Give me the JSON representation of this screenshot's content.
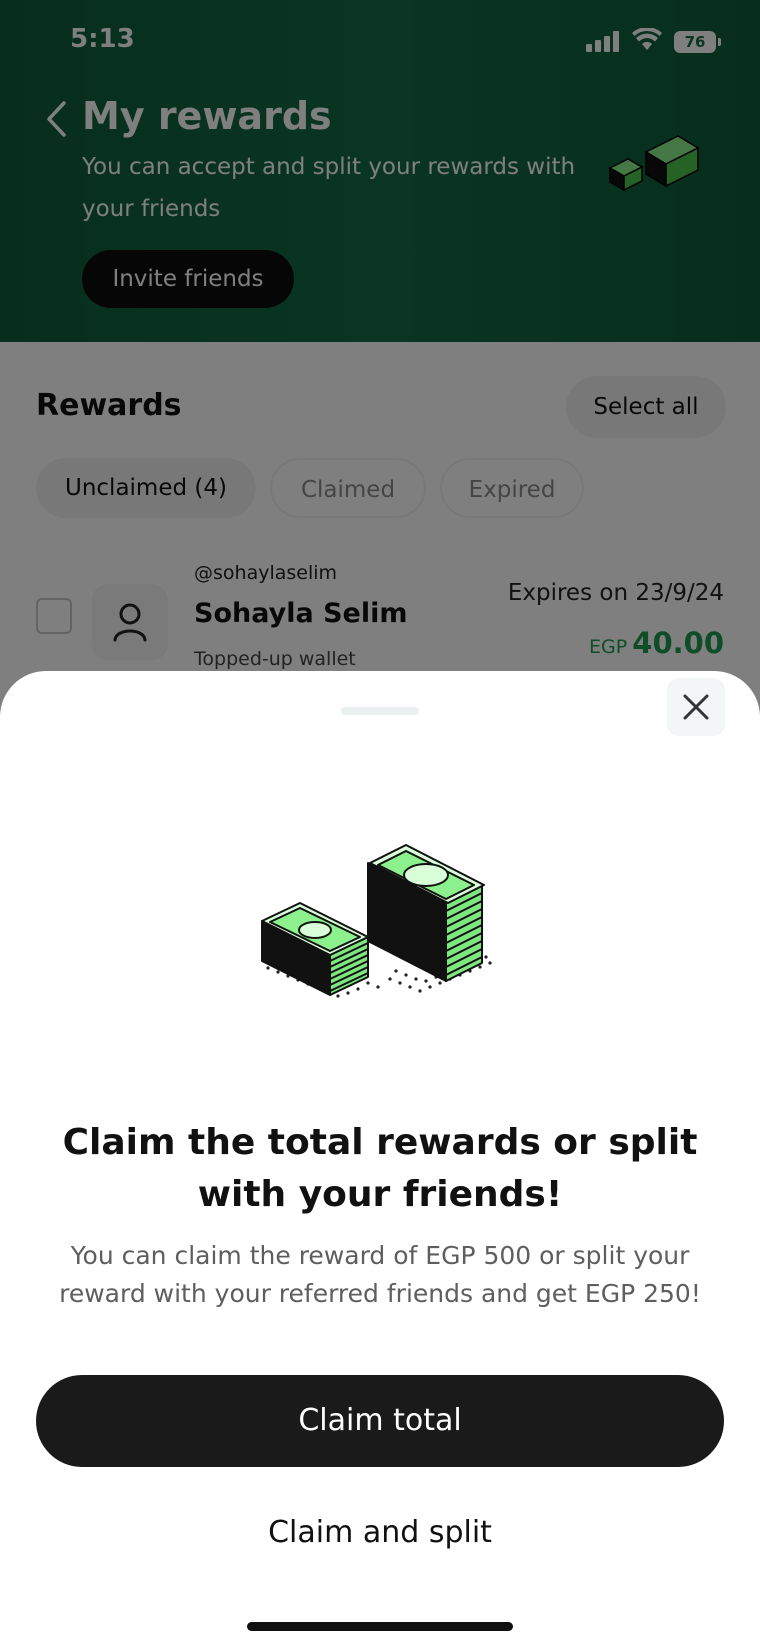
{
  "status_bar": {
    "time": "5:13",
    "battery": "76"
  },
  "header": {
    "title": "My rewards",
    "subtitle": "You can accept and split your rewards with your friends",
    "invite_label": "Invite friends"
  },
  "rewards": {
    "section_title": "Rewards",
    "select_all_label": "Select all",
    "tabs": [
      {
        "label": "Unclaimed (4)",
        "active": true
      },
      {
        "label": "Claimed",
        "active": false
      },
      {
        "label": "Expired",
        "active": false
      }
    ],
    "items": [
      {
        "handle": "@sohaylaselim",
        "name": "Sohayla Selim",
        "description": "Topped-up wallet",
        "expiry": "Expires on 23/9/24",
        "currency": "EGP",
        "amount": "40.00"
      }
    ]
  },
  "sheet": {
    "title": "Claim the total rewards or split with your friends!",
    "body": "You can claim the reward of EGP 500 or split your reward with your referred friends and get EGP 250!",
    "primary_label": "Claim total",
    "secondary_label": "Claim and split"
  },
  "colors": {
    "header_green": "#146b45",
    "accent_green": "#1f9a52",
    "money_green": "#8cf08c",
    "button_dark": "#1a1a1a"
  },
  "icons": [
    "signal-icon",
    "wifi-icon",
    "battery-icon",
    "back-arrow-icon",
    "money-stack-icon",
    "user-icon",
    "close-icon"
  ]
}
